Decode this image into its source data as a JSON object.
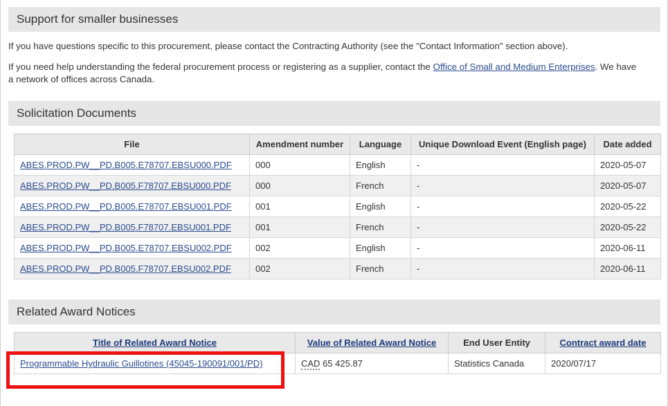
{
  "support_section": {
    "heading": "Support for smaller businesses",
    "paragraph1": "If you have questions specific to this procurement, please contact the Contracting Authority (see the \"Contact Information\" section above).",
    "paragraph2_before": "If you need help understanding the federal procurement process or registering as a supplier, contact the ",
    "paragraph2_link": "Office of Small and Medium Enterprises",
    "paragraph2_after": ". We have a network of offices across Canada."
  },
  "solicitation_section": {
    "heading": "Solicitation Documents",
    "columns": [
      "File",
      "Amendment number",
      "Language",
      "Unique Download Event (English page)",
      "Date added"
    ],
    "rows": [
      {
        "file": "ABES.PROD.PW__PD.B005.E78707.EBSU000.PDF",
        "amendment": "000",
        "language": "English",
        "download_event": "-",
        "date_added": "2020-05-07"
      },
      {
        "file": "ABES.PROD.PW__PD.B005.F78707.EBSU000.PDF",
        "amendment": "000",
        "language": "French",
        "download_event": "-",
        "date_added": "2020-05-07"
      },
      {
        "file": "ABES.PROD.PW__PD.B005.E78707.EBSU001.PDF",
        "amendment": "001",
        "language": "English",
        "download_event": "-",
        "date_added": "2020-05-22"
      },
      {
        "file": "ABES.PROD.PW__PD.B005.F78707.EBSU001.PDF",
        "amendment": "001",
        "language": "French",
        "download_event": "-",
        "date_added": "2020-05-22"
      },
      {
        "file": "ABES.PROD.PW__PD.B005.E78707.EBSU002.PDF",
        "amendment": "002",
        "language": "English",
        "download_event": "-",
        "date_added": "2020-06-11"
      },
      {
        "file": "ABES.PROD.PW__PD.B005.F78707.EBSU002.PDF",
        "amendment": "002",
        "language": "French",
        "download_event": "-",
        "date_added": "2020-06-11"
      }
    ]
  },
  "award_section": {
    "heading": "Related Award Notices",
    "columns": [
      "Title of Related Award Notice",
      "Value of Related Award Notice",
      "End User Entity",
      "Contract award date"
    ],
    "rows": [
      {
        "title": "Programmable Hydraulic Guillotines (45045-190091/001/PD)",
        "value_currency": "CAD",
        "value_amount": "65 425.87",
        "end_user_entity": "Statistics Canada",
        "contract_award_date": "2020/07/17"
      }
    ]
  },
  "annotation": {
    "highlight_color": "#ee1111",
    "target": "related-award-notice-title-link"
  }
}
